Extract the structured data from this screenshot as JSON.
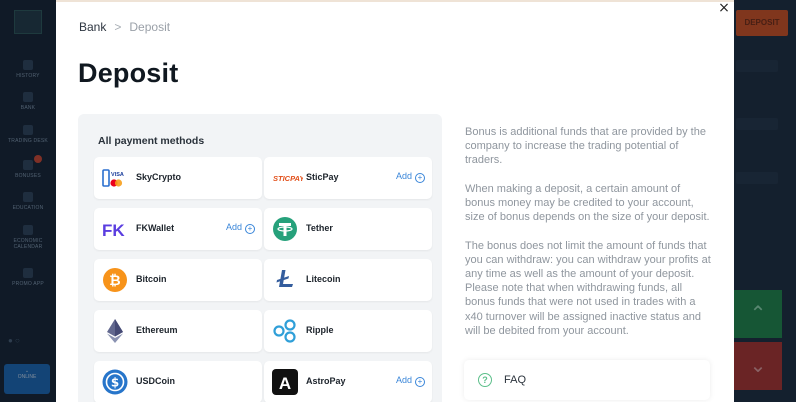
{
  "background": {
    "rail_items": [
      "HISTORY",
      "BANK",
      "TRADING DESK",
      "BONUSES",
      "EDUCATION",
      "ECONOMIC CALENDAR",
      "PROMO APP"
    ],
    "rail_bottom_label": "ONLINE",
    "deposit_button": "DEPOSIT"
  },
  "breadcrumb": {
    "root": "Bank",
    "separator": ">",
    "current": "Deposit"
  },
  "page_title": "Deposit",
  "methods": {
    "title": "All payment methods",
    "add_label": "Add",
    "items": [
      {
        "name": "SkyCrypto",
        "icon": "skycrypto-icon",
        "add": false
      },
      {
        "name": "SticPay",
        "icon": "sticpay-icon",
        "add": true
      },
      {
        "name": "FKWallet",
        "icon": "fkwallet-icon",
        "add": true
      },
      {
        "name": "Tether",
        "icon": "tether-icon",
        "add": false
      },
      {
        "name": "Bitcoin",
        "icon": "bitcoin-icon",
        "add": false
      },
      {
        "name": "Litecoin",
        "icon": "litecoin-icon",
        "add": false
      },
      {
        "name": "Ethereum",
        "icon": "ethereum-icon",
        "add": false
      },
      {
        "name": "Ripple",
        "icon": "ripple-icon",
        "add": false
      },
      {
        "name": "USDCoin",
        "icon": "usdcoin-icon",
        "add": false
      },
      {
        "name": "AstroPay",
        "icon": "astropay-icon",
        "add": true
      }
    ],
    "logo_text": {
      "visa": "VISA",
      "sticpay": "STICPAY",
      "fk": "FK",
      "astropay": "A"
    }
  },
  "bonus_info": [
    "Bonus is additional funds that are provided by the company to increase the trading potential of traders.",
    "When making a deposit, a certain amount of bonus money may be credited to your account, size of bonus depends on the size of your deposit.",
    "The bonus does not limit the amount of funds that you can withdraw: you can withdraw your profits at any time as well as the amount of your deposit. Please note that when withdrawing funds, all bonus funds that were not used in trades with a x40 turnover will be assigned inactive status and will be debited from your account."
  ],
  "faq": {
    "label": "FAQ",
    "icon": "?"
  },
  "close_icon": "×",
  "colors": {
    "accent_blue": "#3a86d9",
    "tether": "#26a17b",
    "bitcoin": "#f7931a",
    "litecoin": "#345d9d",
    "ripple": "#2f9fd8",
    "usdcoin": "#2775ca",
    "fkwallet": "#5a3de0",
    "sticpay": "#e2501b"
  }
}
